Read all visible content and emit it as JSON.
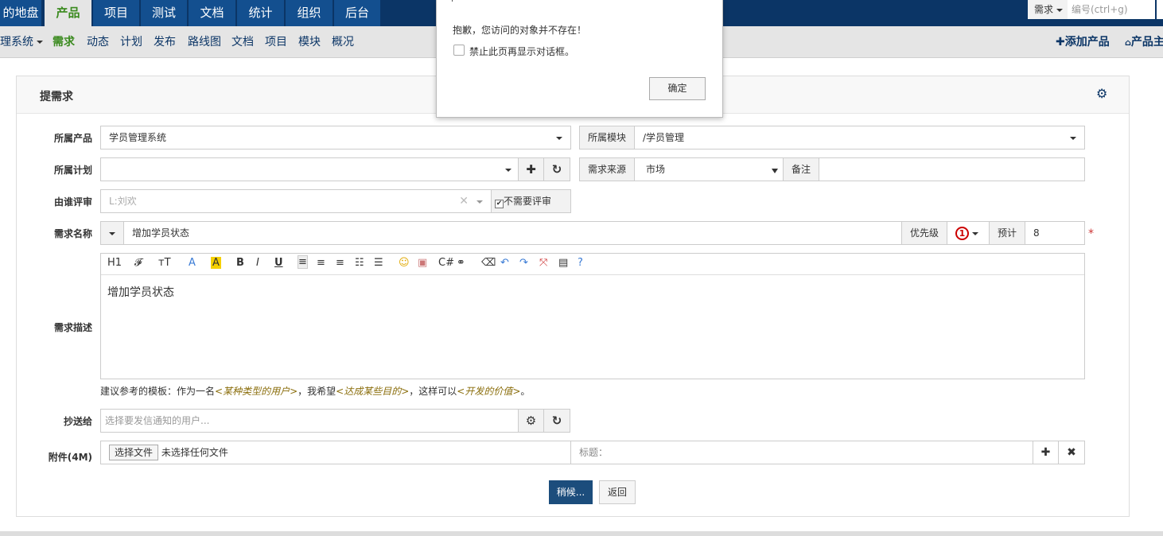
{
  "topnav": {
    "tabs": [
      "的地盘",
      "产品",
      "项目",
      "测试",
      "文档",
      "统计",
      "组织",
      "后台"
    ],
    "active": "产品",
    "search": {
      "type_label": "需求",
      "placeholder": "编号(ctrl+g)"
    }
  },
  "subnav": {
    "product_switch": "理系统",
    "items": [
      "需求",
      "动态",
      "计划",
      "发布",
      "路线图",
      "文档",
      "项目",
      "模块",
      "概况"
    ],
    "active": "需求",
    "add_product": "添加产品",
    "product_home": "产品主"
  },
  "form": {
    "title": "提需求",
    "product": {
      "label": "所属产品",
      "value": "学员管理系统"
    },
    "module": {
      "label": "所属模块",
      "value": "/学员管理"
    },
    "plan": {
      "label": "所属计划",
      "value": ""
    },
    "source": {
      "label": "需求来源",
      "value": "市场"
    },
    "note": {
      "label": "备注",
      "value": ""
    },
    "reviewer": {
      "label": "由谁评审",
      "value": "L:刘欢",
      "no_review_label": "不需要评审",
      "no_review_checked": true
    },
    "name": {
      "label": "需求名称",
      "value": "增加学员状态"
    },
    "priority": {
      "label": "优先级",
      "value": "1"
    },
    "estimate": {
      "label": "预计",
      "value": "8"
    },
    "required_mark": "*",
    "desc": {
      "label": "需求描述",
      "value": "增加学员状态"
    },
    "toolbar": [
      "H1",
      "𝓕",
      "тT",
      "A",
      "A",
      "B",
      "I",
      "U",
      "≡",
      "≡",
      "≡",
      "☷",
      "☰",
      "☺",
      "▣",
      "C#",
      "⚭",
      "⌫",
      "↶",
      "↷",
      "⤧",
      "▤",
      "?"
    ],
    "hint": {
      "prefix": "建议参考的模板：作为一名",
      "p1": "<某种类型的用户>",
      "mid1": "，我希望",
      "p2": "<达成某些目的>",
      "mid2": "，这样可以",
      "p3": "<开发的价值>",
      "suffix": "。"
    },
    "cc": {
      "label": "抄送给",
      "placeholder": "选择要发信通知的用户..."
    },
    "files": {
      "label": "附件(4M)",
      "choose": "选择文件",
      "none": "未选择任何文件",
      "title_placeholder": "标题："
    },
    "save": "稍候...",
    "back": "返回"
  },
  "dialog": {
    "message": "抱歉，您访问的对象并不存在！",
    "suppress": "禁止此页再显示对话框。",
    "ok": "确定"
  },
  "colors": {
    "topbar": "#0b3566",
    "tab": "#134f8f",
    "active_green": "#3a8a1e",
    "primary_button": "#1c4d7c"
  }
}
